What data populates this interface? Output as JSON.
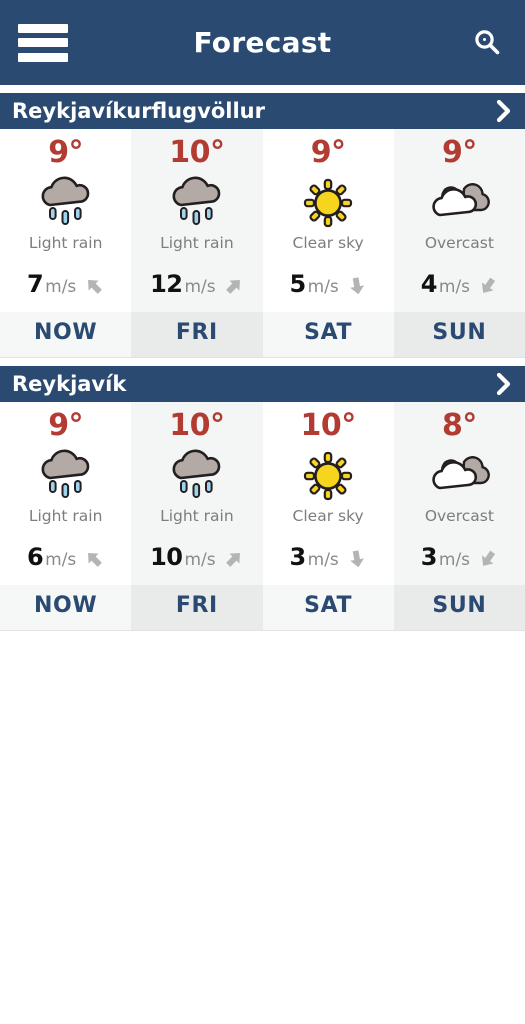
{
  "appbar": {
    "menu_icon": "hamburger-menu-icon",
    "title": "Forecast",
    "search_icon": "search-icon",
    "background_color": "#2a4a72"
  },
  "colors": {
    "brand_navy": "#2a4a72",
    "temp_red": "#b23b32",
    "condition_grey": "#7d7d7d",
    "column_alt_bg": "#f4f5f5",
    "day_strip_bg": "#f6f7f7",
    "day_strip_alt_bg": "#e9eaea",
    "cloud_grey": "#b3a9a5",
    "raindrop_blue": "#9fd4ee",
    "sun_yellow": "#f7d51e"
  },
  "cards": [
    {
      "title": "Reykjavíkurflugvöllur",
      "expand_icon": "chevron-right-icon",
      "columns": [
        {
          "temperature": "9°",
          "icon": "light-rain-icon",
          "condition": "Light rain",
          "wind_speed": "7",
          "wind_unit": "m/s",
          "wind_direction_icon": "arrow-up-left-icon",
          "day": "NOW"
        },
        {
          "temperature": "10°",
          "icon": "light-rain-icon",
          "condition": "Light rain",
          "wind_speed": "12",
          "wind_unit": "m/s",
          "wind_direction_icon": "arrow-up-right-icon",
          "day": "FRI"
        },
        {
          "temperature": "9°",
          "icon": "clear-sky-icon",
          "condition": "Clear sky",
          "wind_speed": "5",
          "wind_unit": "m/s",
          "wind_direction_icon": "arrow-down-icon",
          "day": "SAT"
        },
        {
          "temperature": "9°",
          "icon": "overcast-icon",
          "condition": "Overcast",
          "wind_speed": "4",
          "wind_unit": "m/s",
          "wind_direction_icon": "arrow-down-left-icon",
          "day": "SUN"
        }
      ]
    },
    {
      "title": "Reykjavík",
      "expand_icon": "chevron-right-icon",
      "columns": [
        {
          "temperature": "9°",
          "icon": "light-rain-icon",
          "condition": "Light rain",
          "wind_speed": "6",
          "wind_unit": "m/s",
          "wind_direction_icon": "arrow-up-left-icon",
          "day": "NOW"
        },
        {
          "temperature": "10°",
          "icon": "light-rain-icon",
          "condition": "Light rain",
          "wind_speed": "10",
          "wind_unit": "m/s",
          "wind_direction_icon": "arrow-up-right-icon",
          "day": "FRI"
        },
        {
          "temperature": "10°",
          "icon": "clear-sky-icon",
          "condition": "Clear sky",
          "wind_speed": "3",
          "wind_unit": "m/s",
          "wind_direction_icon": "arrow-down-icon",
          "day": "SAT"
        },
        {
          "temperature": "8°",
          "icon": "overcast-icon",
          "condition": "Overcast",
          "wind_speed": "3",
          "wind_unit": "m/s",
          "wind_direction_icon": "arrow-down-left-icon",
          "day": "SUN"
        }
      ]
    }
  ]
}
